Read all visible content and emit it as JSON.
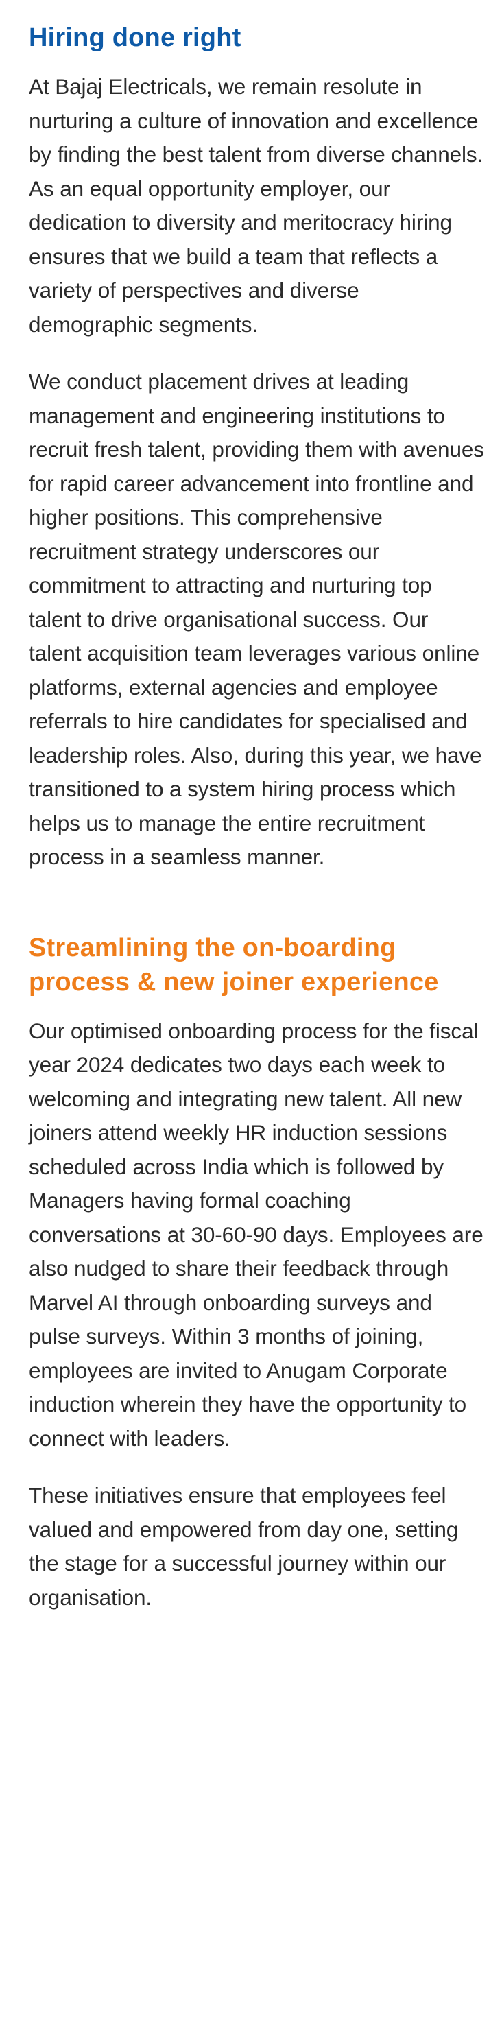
{
  "section1": {
    "heading": "Hiring done right",
    "paragraph1": "At Bajaj Electricals, we remain resolute in nurturing a culture of innovation and excellence by finding the best talent from diverse channels. As an equal opportunity employer, our dedication to diversity and meritocracy hiring ensures that we build a team that reflects a variety of perspectives and diverse demographic segments.",
    "paragraph2": "We conduct placement drives at leading management and engineering institutions to recruit fresh talent, providing them with avenues for rapid career advancement into frontline and higher positions. This comprehensive recruitment strategy underscores our commitment to attracting and nurturing top talent to drive organisational success. Our talent acquisition team leverages various online platforms, external agencies and employee referrals to hire candidates for specialised and leadership roles. Also, during this year, we have transitioned to a system hiring process which helps us to manage the entire recruitment process in a seamless manner."
  },
  "section2": {
    "heading": "Streamlining the on-boarding process & new joiner experience",
    "paragraph1": "Our optimised onboarding process for the fiscal year 2024 dedicates two days each week to welcoming and integrating new talent. All new joiners attend weekly HR induction sessions scheduled across India which is followed by Managers having formal coaching conversations at 30-60-90 days. Employees are also nudged to share their feedback through Marvel AI through onboarding surveys and pulse surveys. Within 3 months of joining, employees are invited to Anugam Corporate induction wherein they have the opportunity to connect with leaders.",
    "paragraph2": "These initiatives ensure that employees feel valued and empowered from day one, setting the stage for a successful journey within our organisation."
  },
  "colors": {
    "heading_blue": "#0e5aa7",
    "heading_orange": "#ef7d1a",
    "body_text": "#2b2b2b",
    "background": "#ffffff"
  }
}
